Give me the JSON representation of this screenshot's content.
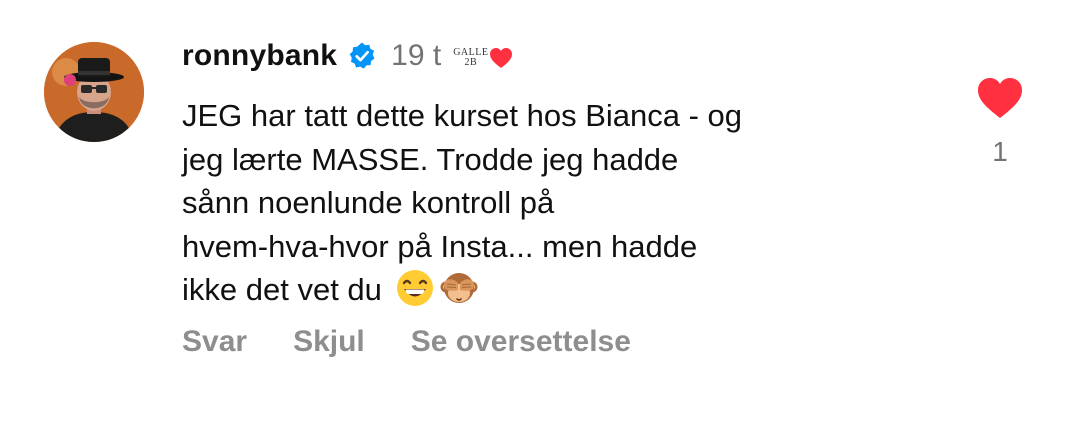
{
  "comment": {
    "author": "ronnybank",
    "verified_icon": "verified-badge-icon",
    "timestamp": "19 t",
    "author_badge": {
      "text_line1": "GALLE",
      "text_line2": "2B",
      "icon": "red-heart-icon"
    },
    "text_lines": [
      "JEG har tatt dette kurset hos Bianca - og",
      "jeg lærte MASSE. Trodde jeg hadde",
      "sånn noenlunde kontroll på",
      "hvem-hva-hvor på Insta... men hadde",
      "ikke det vet du"
    ],
    "emojis": [
      "grinning-face-with-smiling-eyes",
      "see-no-evil-monkey"
    ],
    "actions": {
      "reply": "Svar",
      "hide": "Skjul",
      "translate": "Se oversettelse"
    },
    "like": {
      "icon": "heart-icon",
      "count": "1",
      "liked": true
    }
  },
  "colors": {
    "heart_red": "#ff3040",
    "verified_blue": "#0095f6",
    "secondary_text": "#737373",
    "action_text": "#8e8e8e"
  }
}
